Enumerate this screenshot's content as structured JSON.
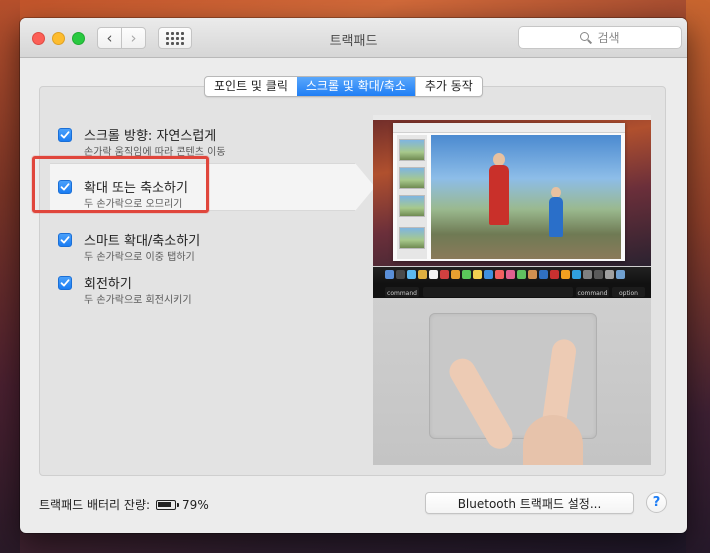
{
  "window": {
    "title": "트랙패드",
    "search_placeholder": "검색"
  },
  "tabs": [
    {
      "label": "포인트 및 클릭",
      "active": false
    },
    {
      "label": "스크롤 및 확대/축소",
      "active": true
    },
    {
      "label": "추가 동작",
      "active": false
    }
  ],
  "options": [
    {
      "title": "스크롤 방향: 자연스럽게",
      "subtitle": "손가락 움직임에 따라 콘텐츠 이동",
      "checked": true
    },
    {
      "title": "확대 또는 축소하기",
      "subtitle": "두 손가락으로 오므리기",
      "checked": true
    },
    {
      "title": "스마트 확대/축소하기",
      "subtitle": "두 손가락으로 이중 탭하기",
      "checked": true
    },
    {
      "title": "회전하기",
      "subtitle": "두 손가락으로 회전시키기",
      "checked": true
    }
  ],
  "preview": {
    "keys": [
      "command",
      "command",
      "option"
    ]
  },
  "footer": {
    "battery_label": "트랙패드 배터리 잔량:",
    "battery_percent": "79%",
    "bluetooth_button": "Bluetooth 트랙패드 설정...",
    "help": "?"
  },
  "colors": {
    "accent": "#1f7ef5",
    "highlight": "#e0463c"
  }
}
